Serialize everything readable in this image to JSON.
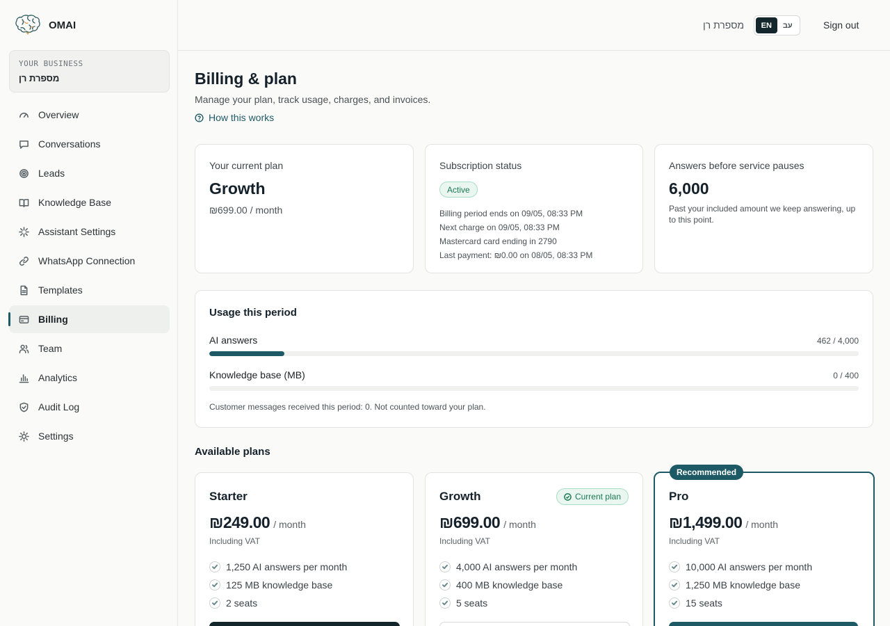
{
  "app": {
    "name": "OMAI"
  },
  "business": {
    "label": "YOUR BUSINESS",
    "name": "מספרת רן"
  },
  "sidebar": {
    "items": [
      {
        "label": "Overview",
        "icon": "gauge-icon"
      },
      {
        "label": "Conversations",
        "icon": "chat-bubble-icon"
      },
      {
        "label": "Leads",
        "icon": "target-icon"
      },
      {
        "label": "Knowledge Base",
        "icon": "book-icon"
      },
      {
        "label": "Assistant Settings",
        "icon": "sparkle-icon"
      },
      {
        "label": "WhatsApp Connection",
        "icon": "link-icon"
      },
      {
        "label": "Templates",
        "icon": "document-icon"
      },
      {
        "label": "Billing",
        "icon": "credit-card-icon",
        "active": true
      },
      {
        "label": "Team",
        "icon": "users-icon"
      },
      {
        "label": "Analytics",
        "icon": "bar-chart-icon"
      },
      {
        "label": "Audit Log",
        "icon": "shield-icon"
      },
      {
        "label": "Settings",
        "icon": "sun-gear-icon"
      }
    ]
  },
  "topbar": {
    "business_name": "מספרת רן",
    "lang_en": "EN",
    "lang_he": "עב",
    "active_lang": "EN",
    "sign_out": "Sign out"
  },
  "page": {
    "title": "Billing & plan",
    "subtitle": "Manage your plan, track usage, charges, and invoices.",
    "how_link": "How this works"
  },
  "current_plan": {
    "label": "Your current plan",
    "name": "Growth",
    "price": "₪699.00 / month"
  },
  "subscription": {
    "label": "Subscription status",
    "status": "Active",
    "lines": [
      "Billing period ends on 09/05, 08:33 PM",
      "Next charge on 09/05, 08:33 PM",
      "Mastercard card ending in 2790",
      "Last payment: ₪0.00 on 08/05, 08:33 PM"
    ]
  },
  "pause": {
    "label": "Answers before service pauses",
    "value": "6,000",
    "note": "Past your included amount we keep answering, up to this point."
  },
  "usage": {
    "title": "Usage this period",
    "meters": [
      {
        "label": "AI answers",
        "value_text": "462 / 4,000",
        "used": 462,
        "limit": 4000
      },
      {
        "label": "Knowledge base (MB)",
        "value_text": "0 / 400",
        "used": 0,
        "limit": 400
      }
    ],
    "note": "Customer messages received this period: 0. Not counted toward your plan."
  },
  "plans_section": {
    "title": "Available plans"
  },
  "plans": [
    {
      "name": "Starter",
      "amount": "₪249.00",
      "per": "/ month",
      "vat": "Including VAT",
      "features": [
        "1,250 AI answers per month",
        "125 MB knowledge base",
        "2 seats"
      ]
    },
    {
      "name": "Growth",
      "amount": "₪699.00",
      "per": "/ month",
      "vat": "Including VAT",
      "badge": "Current plan",
      "features": [
        "4,000 AI answers per month",
        "400 MB knowledge base",
        "5 seats"
      ]
    },
    {
      "name": "Pro",
      "amount": "₪1,499.00",
      "per": "/ month",
      "vat": "Including VAT",
      "badge": "Recommended",
      "features": [
        "10,000 AI answers per month",
        "1,250 MB knowledge base",
        "15 seats"
      ]
    }
  ],
  "colors": {
    "accent": "#1d5a66",
    "dark_button": "#12262b",
    "success": "#1b7a52",
    "background": "#fafaf8"
  }
}
